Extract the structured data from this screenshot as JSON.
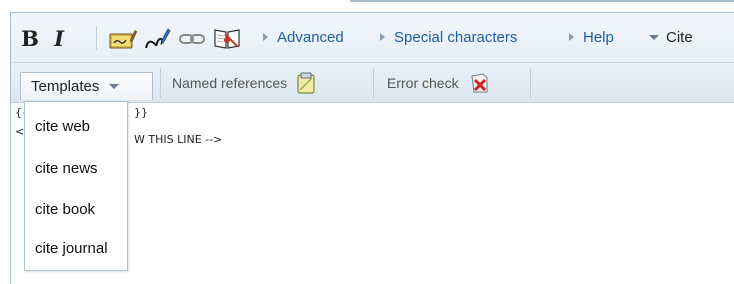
{
  "toolbar": {
    "bold_label": "B",
    "italic_label": "I",
    "advanced_label": "Advanced",
    "special_chars_label": "Special characters",
    "help_label": "Help",
    "cite_label": "Cite",
    "icons": [
      "signature-icon",
      "embedded-file-icon",
      "link-icon",
      "reference-book-icon"
    ]
  },
  "cite_toolbar": {
    "templates_label": "Templates",
    "named_references_label": "Named references",
    "error_check_label": "Error check"
  },
  "dropdown": {
    "items": [
      {
        "label": "cite web"
      },
      {
        "label": "cite news"
      },
      {
        "label": "cite book"
      },
      {
        "label": "cite journal"
      }
    ]
  },
  "editor": {
    "line1_left": "{{",
    "line1_right": "}}",
    "line2_left": "<",
    "line2_right": "W THIS LINE -->"
  }
}
